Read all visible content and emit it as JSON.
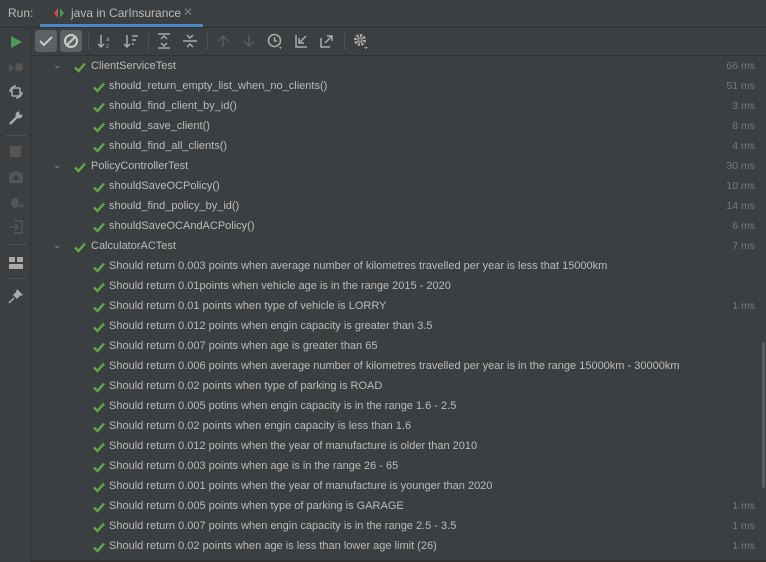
{
  "tabbar": {
    "run_label": "Run:",
    "tab_title": "java in CarInsurance",
    "close_glyph": "✕"
  },
  "colors": {
    "pass": "#5fa845",
    "accent": "#4a88c7",
    "run": "#499c54"
  },
  "sidebar": {
    "icons": [
      "run-icon",
      "rerun-failed-icon",
      "toggle-auto-test-icon",
      "wrench-icon",
      "stop-icon",
      "camera-icon",
      "debug-icon",
      "import-icon",
      "layout-icon",
      "pin-icon"
    ]
  },
  "toolbar": {
    "icons": [
      "show-passed-icon",
      "show-ignored-icon",
      "sort-alphabetically-icon",
      "sort-by-duration-icon",
      "expand-all-icon",
      "collapse-all-icon",
      "previous-test-icon",
      "next-test-icon",
      "test-history-icon",
      "import-tests-icon",
      "export-tests-icon",
      "settings-icon"
    ]
  },
  "tree": {
    "groups": [
      {
        "name": "ClientServiceTest",
        "time": "66 ms",
        "tests": [
          {
            "name": "should_return_empty_list_when_no_clients()",
            "time": "51 ms"
          },
          {
            "name": "should_find_client_by_id()",
            "time": "3 ms"
          },
          {
            "name": "should_save_client()",
            "time": "8 ms"
          },
          {
            "name": "should_find_all_clients()",
            "time": "4 ms"
          }
        ]
      },
      {
        "name": "PolicyControllerTest",
        "time": "30 ms",
        "tests": [
          {
            "name": "shouldSaveOCPolicy()",
            "time": "10 ms"
          },
          {
            "name": "should_find_policy_by_id()",
            "time": "14 ms"
          },
          {
            "name": "shouldSaveOCAndACPolicy()",
            "time": "6 ms"
          }
        ]
      },
      {
        "name": "CalculatorACTest",
        "time": "7 ms",
        "tests": [
          {
            "name": "Should return 0.003 points when average number of kilometres travelled per year is less  that 15000km",
            "time": ""
          },
          {
            "name": "Should return 0.01points when vehicle age is in the range 2015 - 2020",
            "time": ""
          },
          {
            "name": "Should return 0.01 points when type of vehicle is LORRY",
            "time": "1 ms"
          },
          {
            "name": "Should return 0.012 points when engin capacity is greater than 3.5",
            "time": ""
          },
          {
            "name": "Should return 0.007 points when age is greater than 65",
            "time": ""
          },
          {
            "name": "Should return 0.006 points when average number of kilometres travelled per year is in the range 15000km - 30000km",
            "time": ""
          },
          {
            "name": "Should return 0.02 points when type of parking is ROAD",
            "time": ""
          },
          {
            "name": "Should return 0.005 potins when engin capacity is in the range 1.6 - 2.5",
            "time": ""
          },
          {
            "name": "Should return 0.02 points when engin capacity is less than 1.6",
            "time": ""
          },
          {
            "name": "Should return 0.012 points when the year of manufacture is older than 2010",
            "time": ""
          },
          {
            "name": "Should return 0.003 points when age  is in the range 26 - 65",
            "time": ""
          },
          {
            "name": "Should return 0.001 points when the year of manufacture is younger than 2020",
            "time": ""
          },
          {
            "name": "Should return 0.005 points when type of parking is GARAGE",
            "time": "1 ms"
          },
          {
            "name": "Should return 0.007 points when engin capacity is in the range 2.5 - 3.5",
            "time": "1 ms"
          },
          {
            "name": "Should return 0.02 points when age is less than lower age limit (26)",
            "time": "1 ms"
          }
        ]
      }
    ]
  }
}
